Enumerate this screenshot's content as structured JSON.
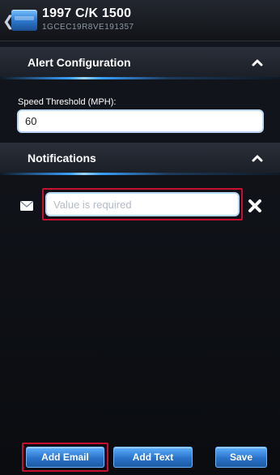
{
  "header": {
    "back_icon": "chevron-left-icon",
    "vehicle_icon": "vehicle-icon",
    "title": "1997 C/K 1500",
    "vin": "1GCEC19R8VE191357"
  },
  "sections": {
    "alert": {
      "title": "Alert Configuration",
      "toggle_icon": "chevron-up-icon"
    },
    "notifications": {
      "title": "Notifications",
      "toggle_icon": "chevron-up-icon"
    }
  },
  "speed_threshold": {
    "label": "Speed Threshold (MPH):",
    "value": "60"
  },
  "email_row": {
    "icon": "envelope-icon",
    "placeholder": "Value is required",
    "value": "",
    "remove_icon": "close-icon",
    "highlight_color": "#c8102e"
  },
  "buttons": {
    "add_email": "Add Email",
    "add_text": "Add Text",
    "save": "Save"
  },
  "colors": {
    "accent": "#3aa0ff",
    "highlight": "#c8102e",
    "button": "#2a73c9"
  }
}
